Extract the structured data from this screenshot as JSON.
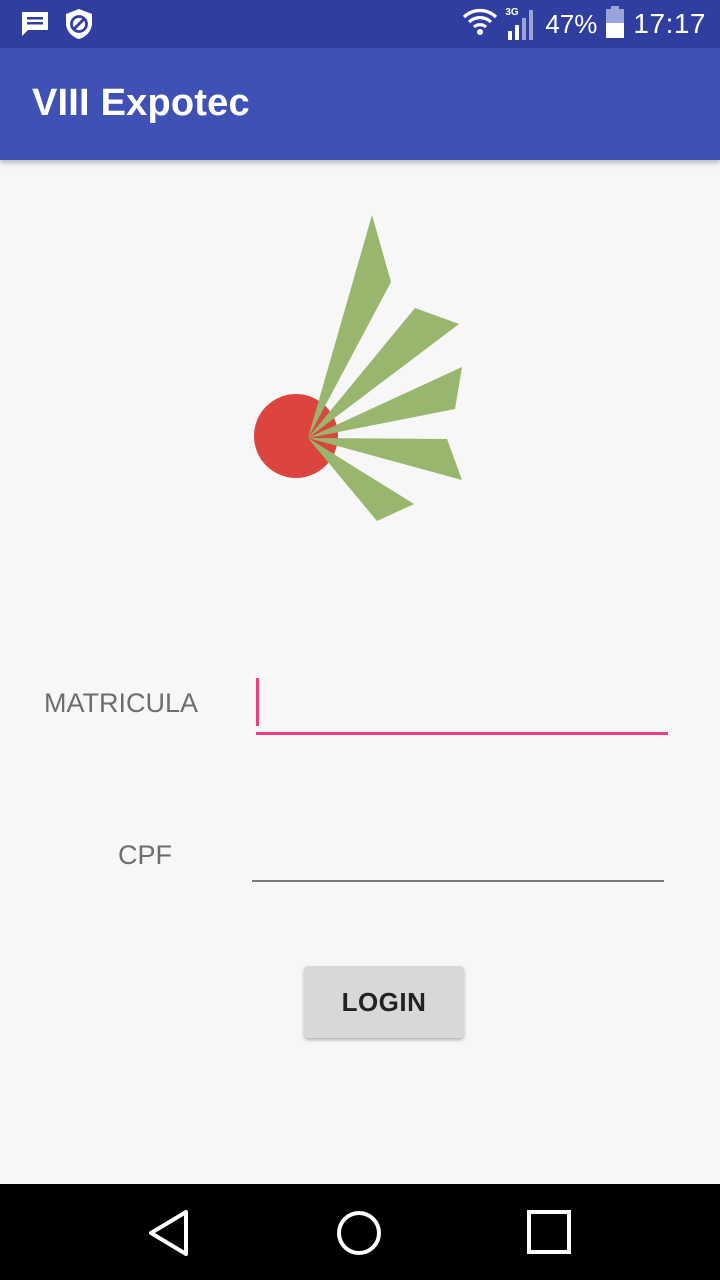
{
  "status_bar": {
    "battery_percent": "47%",
    "time": "17:17",
    "network_type": "3G",
    "icons": [
      "message-icon",
      "data-saver-icon",
      "wifi-icon",
      "signal-icon",
      "battery-icon"
    ]
  },
  "app_bar": {
    "title": "VIII Expotec"
  },
  "logo": {
    "name": "expotec-logo",
    "colors": {
      "circle": "#dc4440",
      "rays": "#98b66e"
    }
  },
  "form": {
    "matricula": {
      "label": "MATRICULA",
      "value": ""
    },
    "cpf": {
      "label": "CPF",
      "value": ""
    },
    "login_label": "LOGIN"
  },
  "nav_bar": {
    "buttons": [
      "back",
      "home",
      "recents"
    ]
  },
  "colors": {
    "primary": "#3f51b5",
    "primary_dark": "#303f9f",
    "accent": "#ef3e7f"
  }
}
